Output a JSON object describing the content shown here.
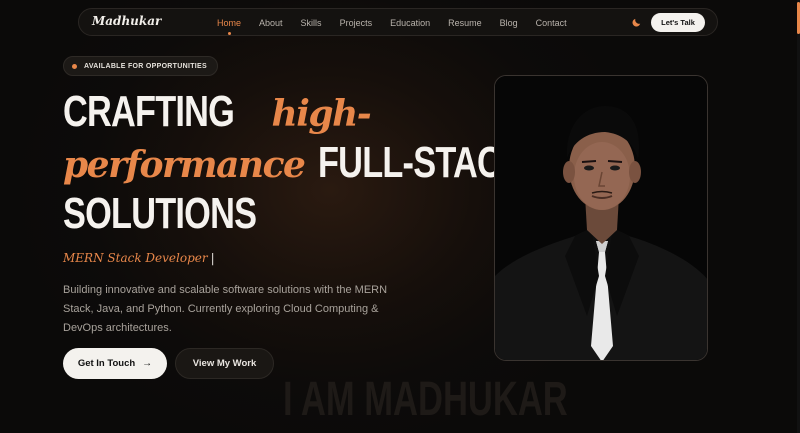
{
  "nav": {
    "logo": "Madhukar",
    "links": [
      "Home",
      "About",
      "Skills",
      "Projects",
      "Education",
      "Resume",
      "Blog",
      "Contact"
    ],
    "active": "Home",
    "theme_icon": "moon-icon",
    "cta": "Let's Talk"
  },
  "hero": {
    "badge": "AVAILABLE FOR OPPORTUNITIES",
    "headline": {
      "w1": "CRAFTING",
      "w2": "high-",
      "w3": "performance",
      "w4": "FULL-STACK",
      "w5": "SOLUTIONS"
    },
    "role": "MERN Stack Developer",
    "role_cursor": "|",
    "description": "Building innovative and scalable software solutions with the MERN Stack, Java, and Python. Currently exploring Cloud Computing & DevOps architectures.",
    "primary_btn": "Get In Touch",
    "primary_arrow": "→",
    "secondary_btn": "View My Work",
    "watermark": "I AM MADHUKAR"
  },
  "colors": {
    "accent": "#e8874a",
    "background": "#0d0b0a",
    "text": "#f5f2ee"
  }
}
